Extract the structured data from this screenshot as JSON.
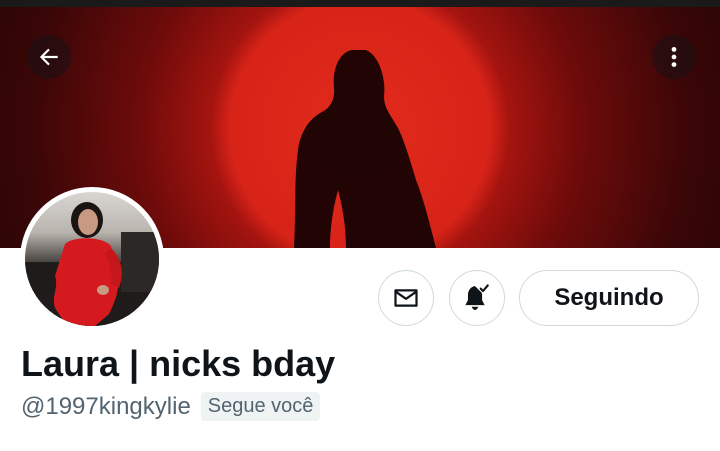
{
  "header": {
    "back_icon": "arrow-left-icon",
    "more_icon": "more-vertical-icon"
  },
  "profile": {
    "display_name": "Laura | nicks bday",
    "handle": "@1997kingkylie",
    "follows_you_label": "Segue você",
    "avatar": "profile-photo",
    "banner": "red-circle-silhouette-banner"
  },
  "actions": {
    "message_icon": "envelope-icon",
    "notifications_icon": "bell-check-icon",
    "follow_label": "Seguindo"
  },
  "colors": {
    "banner_red": "#d72318",
    "text_primary": "#0f1419",
    "text_secondary": "#536471",
    "border": "#cfd9de",
    "badge_bg": "#eff3f4"
  }
}
